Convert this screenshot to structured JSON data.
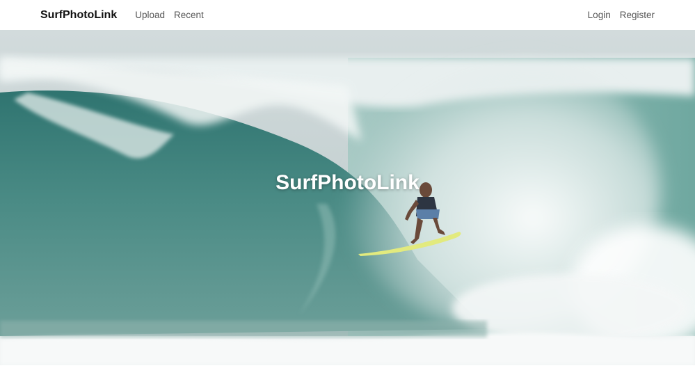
{
  "navbar": {
    "brand": "SurfPhotoLink",
    "links_left": [
      "Upload",
      "Recent"
    ],
    "links_right": [
      "Login",
      "Register"
    ]
  },
  "hero": {
    "title": "SurfPhotoLink",
    "image": "surfer riding a barrel wave"
  },
  "colors": {
    "wave_dark": "#3d7f7a",
    "wave_mid": "#5b958f",
    "foam": "#eef3f2",
    "sky": "#c9d3d4",
    "board": "#e4ec84"
  }
}
